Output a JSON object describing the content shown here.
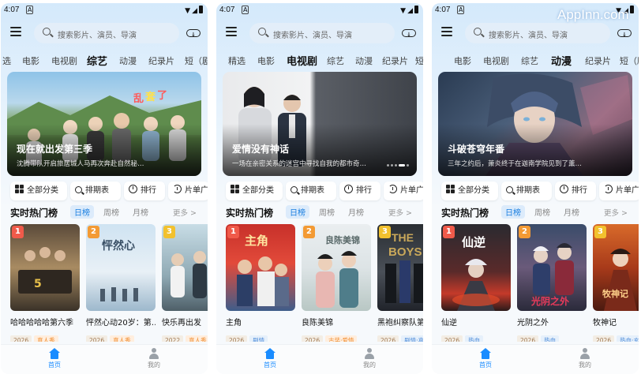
{
  "status": {
    "time": "4:07",
    "notif": "A"
  },
  "search": {
    "placeholder": "搜索影片、演员、导演"
  },
  "watermark": "AppInn.com",
  "quick": [
    "全部分类",
    "排期表",
    "排行",
    "片单广场"
  ],
  "rank": {
    "title": "实时热门榜",
    "tabs": [
      "日榜",
      "周榜",
      "月榜"
    ],
    "more": "更多 >"
  },
  "nav": {
    "home": "首页",
    "mine": "我的"
  },
  "colors": {
    "accent": "#1a8cff",
    "rank1": "#f05a4a",
    "rank2": "#f39a34",
    "rank3": "#f2c12e"
  },
  "screens": [
    {
      "tabs": [
        "选",
        "电影",
        "电视剧",
        "综艺",
        "动漫",
        "纪录片",
        "短（剧"
      ],
      "active_tab": 3,
      "banner": {
        "title": "现在就出发第三季",
        "desc": "沈腾带队开启旅居城人马再次奔赴自然秘…"
      },
      "cards": [
        {
          "rank": "1",
          "title": "哈哈哈哈哈第六季",
          "tags": [
            "2026",
            "真人秀"
          ]
        },
        {
          "rank": "2",
          "title": "怦然心动20岁：第…",
          "tags": [
            "2026",
            "真人秀"
          ]
        },
        {
          "rank": "3",
          "title": "快乐再出发",
          "tags": [
            "2022",
            "真人秀"
          ]
        }
      ]
    },
    {
      "tabs": [
        "精选",
        "电影",
        "电视剧",
        "综艺",
        "动漫",
        "纪录片",
        "短"
      ],
      "active_tab": 2,
      "banner": {
        "title": "爱情没有神话",
        "desc": "一场在亲密关系的迷宫中寻找自我的都市奇…"
      },
      "cards": [
        {
          "rank": "1",
          "title": "主角",
          "tags": [
            "2026",
            "剧情"
          ]
        },
        {
          "rank": "2",
          "title": "良陈美锦",
          "tags": [
            "2026",
            "古装·爱情"
          ]
        },
        {
          "rank": "3",
          "title": "黑袍纠察队第五季",
          "tags": [
            "2026",
            "剧情·喜"
          ]
        }
      ]
    },
    {
      "tabs": [
        "电影",
        "电视剧",
        "综艺",
        "动漫",
        "纪录片",
        "短（剧集）"
      ],
      "active_tab": 3,
      "banner": {
        "title": "斗破苍穹年番",
        "desc": "三年之约后，萧炎终于在迦南学院见到了薰…"
      },
      "cards": [
        {
          "rank": "1",
          "title": "仙逆",
          "tags": [
            "2026",
            "热血"
          ]
        },
        {
          "rank": "2",
          "title": "光阴之外",
          "tags": [
            "2026",
            "热血"
          ]
        },
        {
          "rank": "3",
          "title": "牧神记",
          "tags": [
            "2026",
            "热血·玄"
          ]
        }
      ]
    }
  ]
}
